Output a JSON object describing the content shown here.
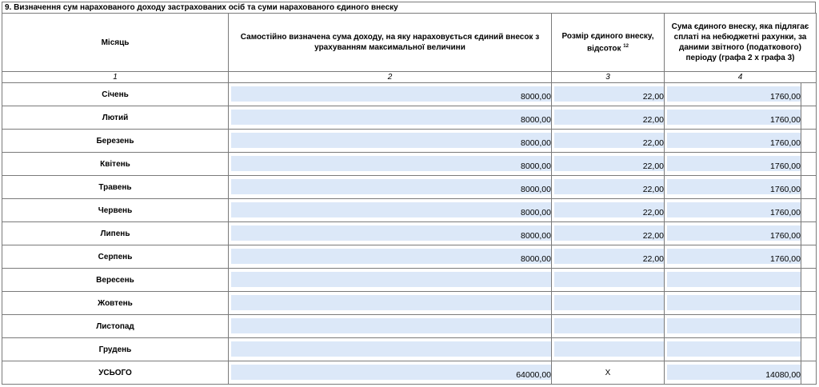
{
  "section_title": "9. Визначення сум нарахованого доходу застрахованих осіб та суми нарахованого єдиного внеску",
  "headers": {
    "month": "Місяць",
    "income": "Самостійно визначена сума доходу, на яку нараховується єдиний внесок з урахуванням максимальної величини",
    "rate": "Розмір єдиного внеску, відсоток",
    "rate_footnote": "12",
    "contribution": "Сума єдиного внеску, яка підлягає сплаті на небюджетні рахунки, за даними звітного (податкового) періоду (графа 2 х графа 3)"
  },
  "column_numbers": [
    "1",
    "2",
    "3",
    "4"
  ],
  "rows": [
    {
      "month": "Січень",
      "income": "8000,00",
      "rate": "22,00",
      "contribution": "1760,00"
    },
    {
      "month": "Лютий",
      "income": "8000,00",
      "rate": "22,00",
      "contribution": "1760,00"
    },
    {
      "month": "Березень",
      "income": "8000,00",
      "rate": "22,00",
      "contribution": "1760,00"
    },
    {
      "month": "Квітень",
      "income": "8000,00",
      "rate": "22,00",
      "contribution": "1760,00"
    },
    {
      "month": "Травень",
      "income": "8000,00",
      "rate": "22,00",
      "contribution": "1760,00"
    },
    {
      "month": "Червень",
      "income": "8000,00",
      "rate": "22,00",
      "contribution": "1760,00"
    },
    {
      "month": "Липень",
      "income": "8000,00",
      "rate": "22,00",
      "contribution": "1760,00"
    },
    {
      "month": "Серпень",
      "income": "8000,00",
      "rate": "22,00",
      "contribution": "1760,00"
    },
    {
      "month": "Вересень",
      "income": "",
      "rate": "",
      "contribution": ""
    },
    {
      "month": "Жовтень",
      "income": "",
      "rate": "",
      "contribution": ""
    },
    {
      "month": "Листопад",
      "income": "",
      "rate": "",
      "contribution": ""
    },
    {
      "month": "Грудень",
      "income": "",
      "rate": "",
      "contribution": ""
    }
  ],
  "total": {
    "label": "УСЬОГО",
    "income": "64000,00",
    "rate": "Х",
    "contribution": "14080,00"
  },
  "colors": {
    "field_fill": "#dce8f8",
    "border": "#7a7a7a"
  }
}
